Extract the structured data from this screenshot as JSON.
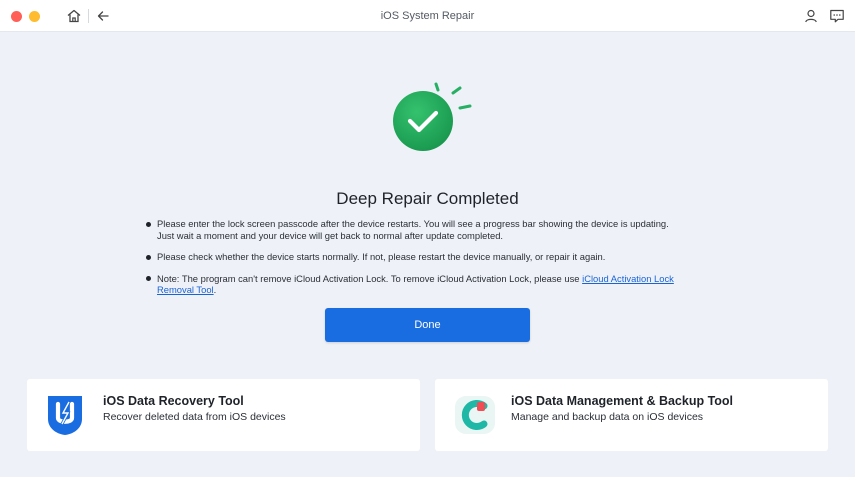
{
  "window": {
    "title": "iOS System Repair",
    "controls": [
      "close",
      "minimize"
    ],
    "toolbar_icons": [
      "home-icon",
      "back-arrow-icon",
      "user-icon",
      "feedback-icon"
    ]
  },
  "main": {
    "status_icon": "checkmark-icon",
    "heading": "Deep Repair Completed",
    "bullets": [
      {
        "line1": "Please enter the lock screen passcode after the device restarts. You will see a progress bar showing the device is updating.",
        "line2": "Just wait a moment and your device will get back to normal after update completed."
      },
      {
        "line1": "Please check whether the device starts normally. If not, please restart the device manually, or repair it again."
      },
      {
        "prefix": "Note: The program can't remove iCloud Activation Lock. To remove iCloud Activation Lock, please use ",
        "link_line1": "iCloud Activation Lock",
        "link_line2": "Removal Tool",
        "suffix": "."
      }
    ],
    "done_label": "Done"
  },
  "tools": [
    {
      "title": "iOS Data Recovery Tool",
      "description": "Recover deleted data from iOS devices",
      "icon": "data-recovery-logo-icon",
      "color": "#1a6de0"
    },
    {
      "title": "iOS Data Management & Backup Tool",
      "description": "Manage and backup data on iOS devices",
      "icon": "data-management-logo-icon",
      "color": "#1fb8a6"
    }
  ],
  "colors": {
    "accent": "#1a6de0",
    "success": "#21a65b",
    "background": "#eef2f8"
  }
}
